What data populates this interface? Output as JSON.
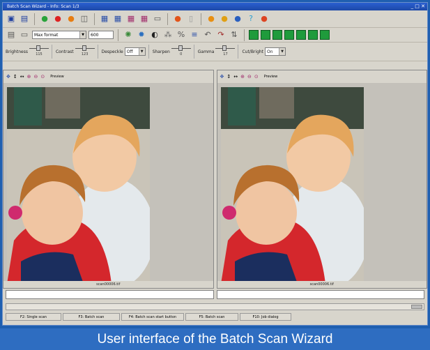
{
  "window": {
    "title": "Batch Scan Wizard - Info: Scan 1/3"
  },
  "toolbar2": {
    "format_value": "Max format",
    "dpi_value": "600"
  },
  "adjustments": [
    {
      "label": "Brightness",
      "value": "115"
    },
    {
      "label": "Contrast",
      "value": "123"
    },
    {
      "label": "Despeckle",
      "select": "Off"
    },
    {
      "label": "Sharpen",
      "value": "0"
    },
    {
      "label": "Gamma",
      "value": "17"
    },
    {
      "label": "Cut/Bright",
      "select": "On"
    }
  ],
  "panes": [
    {
      "preview_label": "Preview",
      "filename": "scan00006.tif"
    },
    {
      "preview_label": "Preview",
      "filename": "scan00006.tif"
    }
  ],
  "function_keys": [
    "F2: Single scan",
    "F3: Batch scan",
    "F4: Batch scan start button",
    "F5: Batch scan",
    "F10: Job dialog"
  ],
  "caption": "User interface of the Batch Scan Wizard",
  "colors": {
    "frame": "#1f5fb0",
    "caption_bg": "#2e6dc1",
    "title": "#1d49a8"
  }
}
